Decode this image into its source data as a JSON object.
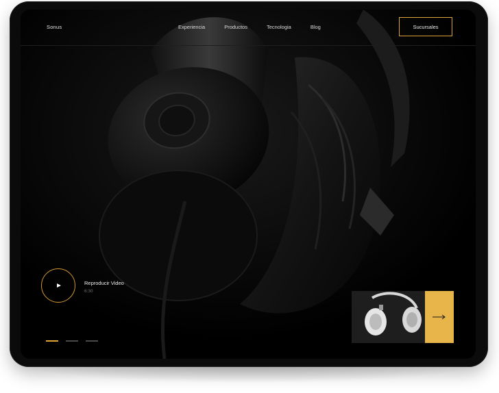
{
  "nav": {
    "brand": "Sonus",
    "links": [
      "Experiencia",
      "Productos",
      "Tecnologia",
      "Blog"
    ],
    "cta": "Sucursales"
  },
  "hero": {
    "video_label": "Reproducir Video",
    "video_duration": "6:30",
    "slides_total": 3,
    "slide_active": 1
  },
  "colors": {
    "accent": "#e0a63a",
    "accent_fill": "#e8b54a",
    "background": "#000000"
  },
  "icons": {
    "play": "play-icon",
    "arrow": "arrow-right-icon"
  }
}
